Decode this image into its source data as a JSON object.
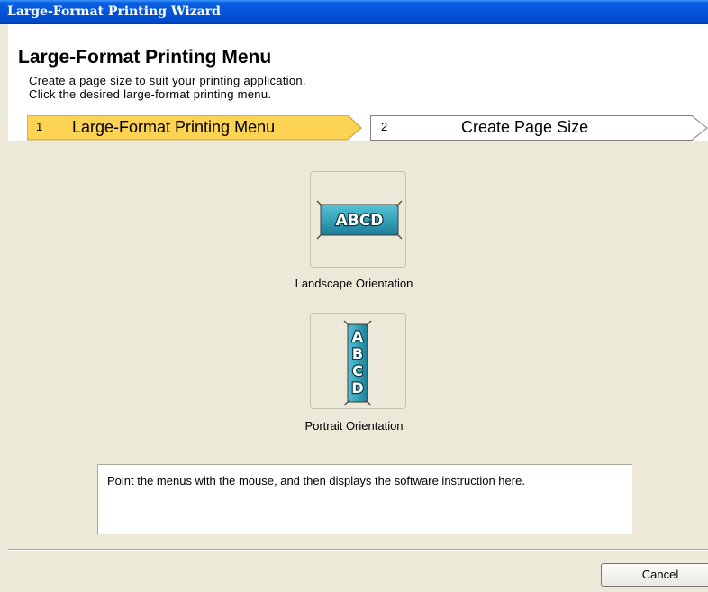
{
  "window": {
    "title": "Large-Format Printing Wizard"
  },
  "header": {
    "title": "Large-Format Printing Menu",
    "description_line1": "Create a page size to suit your printing application.",
    "description_line2": "Click the desired large-format printing menu."
  },
  "steps": [
    {
      "number": "1",
      "label": "Large-Format Printing Menu",
      "active": true
    },
    {
      "number": "2",
      "label": "Create Page Size",
      "active": false
    }
  ],
  "menu": {
    "landscape": {
      "label": "Landscape Orientation",
      "icon_text": "ABCD",
      "icon": "landscape-banner-icon"
    },
    "portrait": {
      "label": "Portrait Orientation",
      "icon_letters": [
        "A",
        "B",
        "C",
        "D"
      ],
      "icon": "portrait-banner-icon"
    }
  },
  "info": {
    "text": "Point the menus with the mouse, and then displays the software instruction here."
  },
  "footer": {
    "cancel_label": "Cancel"
  },
  "colors": {
    "active_step": "#fcd352",
    "banner": "#2a9fb6",
    "titlebar": "#0353d8"
  }
}
